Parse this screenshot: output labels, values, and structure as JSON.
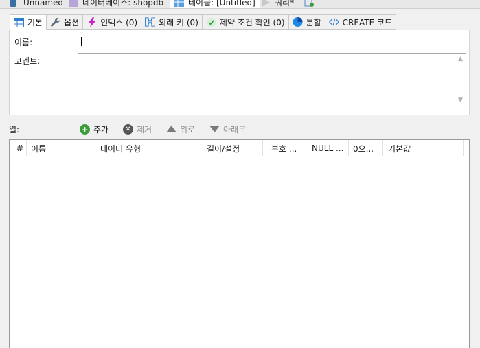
{
  "document_tabs": [
    {
      "label": "Unnamed",
      "icon": "connection-icon"
    },
    {
      "label": "데이터베이스: shopdb",
      "icon": "database-icon"
    },
    {
      "label": "테이블: [Untitled]",
      "icon": "table-icon",
      "active": true
    },
    {
      "label": "쿼리*",
      "icon": "run-icon"
    },
    {
      "label": "",
      "icon": "new-query-icon"
    }
  ],
  "inner_tabs": [
    {
      "label": "기본",
      "icon": "table-grid-icon",
      "active": true
    },
    {
      "label": "옵션",
      "icon": "wrench-icon"
    },
    {
      "label": "인덱스 (0)",
      "icon": "lightning-icon"
    },
    {
      "label": "외래 키 (0)",
      "icon": "foreign-key-icon"
    },
    {
      "label": "제약 조건 확인 (0)",
      "icon": "check-icon"
    },
    {
      "label": "분할",
      "icon": "partition-icon"
    },
    {
      "label": "CREATE 코드",
      "icon": "code-icon"
    }
  ],
  "form": {
    "name_label": "이름:",
    "name_value": "",
    "comment_label": "코멘트:",
    "comment_value": ""
  },
  "columns_toolbar": {
    "label": "열:",
    "add": "추가",
    "remove": "제거",
    "up": "위로",
    "down": "아래로"
  },
  "grid": {
    "headers": [
      "#",
      "이름",
      "데이터 유형",
      "길이/설정",
      "부호 ...",
      "NULL ...",
      "0으...",
      "기본값"
    ],
    "rows": []
  },
  "colors": {
    "add_green": "#3a9d3a",
    "remove_gray": "#555555",
    "input_focus_border": "#3c84a8",
    "check_green": "#4caf50",
    "lightning_magenta": "#cc22cc",
    "partition_blue": "#1e88e5"
  }
}
